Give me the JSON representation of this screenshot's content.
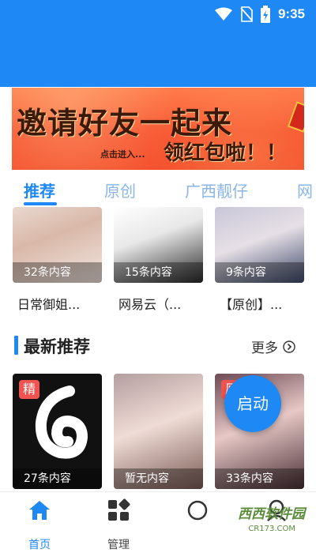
{
  "status_bar": {
    "time": "9:35"
  },
  "banner": {
    "title": "邀请好友一起来",
    "sub": "点击进入...",
    "red": "领红包啦！！"
  },
  "tabs": [
    "推荐",
    "原创",
    "广西靓仔",
    "网"
  ],
  "top_cards": [
    {
      "count": "32条内容",
      "title": "日常御姐..."
    },
    {
      "count": "15条内容",
      "title": "网易云（..."
    },
    {
      "count": "9条内容",
      "title": "【原创】..."
    }
  ],
  "section": {
    "title": "最新推荐",
    "more": "更多"
  },
  "bottom_cards": [
    {
      "badge": "精",
      "count": "27条内容"
    },
    {
      "count": "暂无内容"
    },
    {
      "badge": "原",
      "count": "33条内容"
    }
  ],
  "fab_label": "启动",
  "nav": [
    {
      "label": "首页",
      "icon": "home-icon"
    },
    {
      "label": "管理",
      "icon": "grid-icon"
    },
    {
      "label": "",
      "icon": ""
    },
    {
      "label": "",
      "icon": "profile-icon"
    }
  ],
  "watermark": {
    "text": "西西软件园",
    "sub": "CR173.COM"
  },
  "colors": {
    "primary": "#1e88f5",
    "tab_inactive": "#8ab6e6",
    "badge": "#f05350"
  }
}
